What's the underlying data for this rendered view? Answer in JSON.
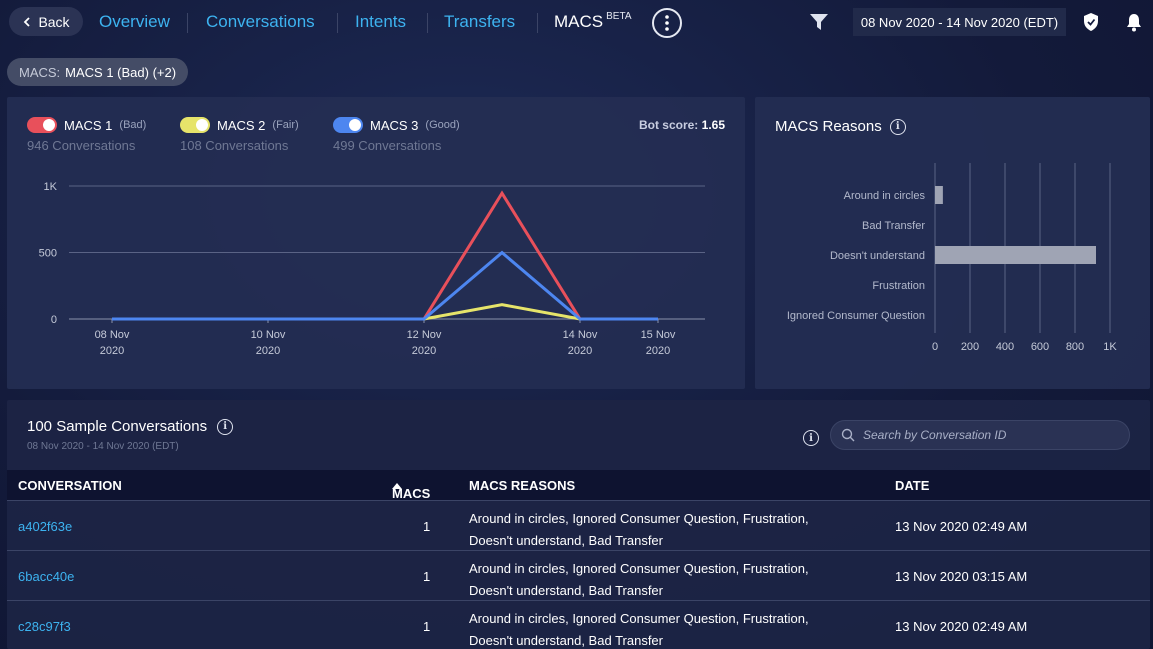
{
  "nav": {
    "back_label": "Back",
    "tabs": [
      "Overview",
      "Conversations",
      "Intents",
      "Transfers"
    ],
    "active_tab": "MACS",
    "beta_label": "BETA",
    "date_range": "08 Nov 2020 - 14 Nov 2020 (EDT)"
  },
  "filter_chip": {
    "key": "MACS:",
    "value": "MACS 1 (Bad) (+2)"
  },
  "legend": [
    {
      "name": "MACS 1",
      "quality": "(Bad)",
      "count": "946 Conversations",
      "color": "#e8505b"
    },
    {
      "name": "MACS 2",
      "quality": "(Fair)",
      "count": "108 Conversations",
      "color": "#e6e46a"
    },
    {
      "name": "MACS 3",
      "quality": "(Good)",
      "count": "499 Conversations",
      "color": "#4d86f0"
    }
  ],
  "bot_score": {
    "label": "Bot score:",
    "value": "1.65"
  },
  "chart_data": [
    {
      "type": "line",
      "x": [
        "08 Nov 2020",
        "09 Nov 2020",
        "10 Nov 2020",
        "11 Nov 2020",
        "12 Nov 2020",
        "13 Nov 2020",
        "14 Nov 2020",
        "15 Nov 2020"
      ],
      "xticks": [
        {
          "l1": "08 Nov",
          "l2": "2020",
          "i": 0
        },
        {
          "l1": "10 Nov",
          "l2": "2020",
          "i": 2
        },
        {
          "l1": "12 Nov",
          "l2": "2020",
          "i": 4
        },
        {
          "l1": "14 Nov",
          "l2": "2020",
          "i": 6
        },
        {
          "l1": "15 Nov",
          "l2": "2020",
          "i": 7
        }
      ],
      "yticks": [
        "0",
        "500",
        "1K"
      ],
      "ylim": [
        0,
        1000
      ],
      "series": [
        {
          "name": "MACS 1",
          "color": "#e8505b",
          "values": [
            0,
            0,
            0,
            0,
            0,
            946,
            0,
            0
          ]
        },
        {
          "name": "MACS 2",
          "color": "#e6e46a",
          "values": [
            0,
            0,
            0,
            0,
            0,
            108,
            0,
            0
          ]
        },
        {
          "name": "MACS 3",
          "color": "#4d86f0",
          "values": [
            0,
            0,
            0,
            0,
            0,
            499,
            0,
            0
          ]
        }
      ]
    },
    {
      "type": "bar",
      "title": "MACS Reasons",
      "categories": [
        "Around in circles",
        "Bad Transfer",
        "Doesn't understand",
        "Frustration",
        "Ignored Consumer Question"
      ],
      "values": [
        45,
        0,
        920,
        0,
        0
      ],
      "xticks": [
        "0",
        "200",
        "400",
        "600",
        "800",
        "1K"
      ],
      "xlim": [
        0,
        1000
      ]
    }
  ],
  "table": {
    "title": "100 Sample Conversations",
    "subtitle": "08 Nov 2020 - 14 Nov 2020 (EDT)",
    "search_placeholder": "Search by Conversation ID",
    "columns": [
      "CONVERSATION",
      "MACS",
      "MACS REASONS",
      "DATE"
    ],
    "rows": [
      {
        "id": "a402f63e",
        "macs": "1",
        "reasons": "Around in circles, Ignored Consumer Question, Frustration, Doesn't understand, Bad Transfer",
        "date": "13 Nov 2020 02:49 AM"
      },
      {
        "id": "6bacc40e",
        "macs": "1",
        "reasons": "Around in circles, Ignored Consumer Question, Frustration, Doesn't understand, Bad Transfer",
        "date": "13 Nov 2020 03:15 AM"
      },
      {
        "id": "c28c97f3",
        "macs": "1",
        "reasons": "Around in circles, Ignored Consumer Question, Frustration, Doesn't understand, Bad Transfer",
        "date": "13 Nov 2020 02:49 AM"
      }
    ]
  }
}
